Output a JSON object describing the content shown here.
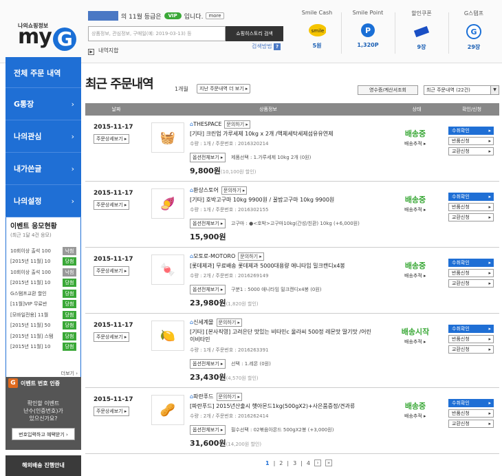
{
  "header": {
    "logo_small": "나의쇼핑정보",
    "logo_text": "my",
    "logo_g": "G",
    "grade_text": "의 11월 등급은",
    "grade_badge": "VIP",
    "grade_suffix": "입니다.",
    "more_label": "more",
    "search_placeholder": "상품정보, 관심정보, 구매일(예: 2019-03-13) 등",
    "search_button": "쇼핑히스토리 검색",
    "search_help": "검색방법",
    "history_label": "내역지합",
    "boxes": [
      {
        "label": "Smile Cash",
        "value": "5원",
        "icon": "smile-icon"
      },
      {
        "label": "Smile Point",
        "value": "1,320P",
        "icon": "point-icon"
      },
      {
        "label": "할인쿠폰",
        "value": "9장",
        "icon": "coupon-icon"
      },
      {
        "label": "G스탬프",
        "value": "29장",
        "icon": "stamp-icon"
      }
    ]
  },
  "sidebar": {
    "items": [
      {
        "label": "전체 주문 내역"
      },
      {
        "label": "G통장"
      },
      {
        "label": "나의관심"
      },
      {
        "label": "내가쓴글"
      },
      {
        "label": "나의설정"
      }
    ],
    "event": {
      "title": "이벤트 응모현황",
      "subtitle": "(최근 1달 4건 응모)",
      "rows": [
        {
          "name": "10회이상 출석 100",
          "result": "낙첨",
          "win": false
        },
        {
          "name": "[2015년 11월] 10",
          "result": "당첨",
          "win": true
        },
        {
          "name": "10회이상 출석 100",
          "result": "낙첨",
          "win": false
        },
        {
          "name": "[2015년 11월] 10",
          "result": "당첨",
          "win": true
        },
        {
          "name": "G스탬프교환 할인",
          "result": "당첨",
          "win": true
        },
        {
          "name": "[11월]VIP 무료반",
          "result": "당첨",
          "win": true
        },
        {
          "name": "[모바일전용] 11월",
          "result": "당첨",
          "win": true
        },
        {
          "name": "[2015년 11월] 50",
          "result": "당첨",
          "win": true
        },
        {
          "name": "[2015년 11월] 스탬",
          "result": "당첨",
          "win": true
        },
        {
          "name": "[2015년 11월] 10",
          "result": "당첨",
          "win": true
        }
      ],
      "more": "더보기"
    },
    "verify": {
      "title": "이벤트 번호 인증",
      "text1": "확인할 이벤트",
      "text2": "난수(인증번호)가",
      "text3": "있으신가요?",
      "button": "번호입력하고 혜택받기"
    },
    "overseas": "해외배송 진행안내"
  },
  "main": {
    "title": "최근 주문내역",
    "period": "1개월",
    "title_more": "지난 주문내역 더 보기",
    "receipt_button": "영수증/계산서조회",
    "select_value": "최근 주문내역 (22건)",
    "columns": [
      "날짜",
      "상품정보",
      "상태",
      "확인/신청"
    ],
    "orders": [
      {
        "date": "2015-11-17",
        "detail_btn": "주문상세보기",
        "shop": "THESPACE",
        "inquiry": "문의하기",
        "name": "[기타] 크린업 가루세제 10kg x 2개 /액체세탁세제섬유유연제",
        "meta": "수량 : 1개 / 주문번호 : 2016320214",
        "opt_btn": "옵션전체보기",
        "option": "제품선택 : 1.가루세제 10kg 2개 (0원)",
        "price": "9,800원",
        "discount": "(10,100원 할인)",
        "status": "배송중",
        "track": "배송추적",
        "actions": [
          "수취확인",
          "반품신청",
          "교환신청"
        ]
      },
      {
        "date": "2015-11-17",
        "detail_btn": "주문상세보기",
        "shop": "환상스토어",
        "inquiry": "문의하기",
        "name": "[기타] 호박고구마 10kg 9900원 / 꿀밤고구마 10kg 9900원",
        "meta": "수량 : 1개 / 주문번호 : 2016302155",
        "opt_btn": "옵션전체보기",
        "option": "고구마 : ●<호박>고구마10kg(간성/친환) 10kg (+6,000원)",
        "price": "15,900원",
        "discount": "",
        "status": "배송중",
        "track": "배송추적",
        "actions": [
          "수취확인",
          "반품신청",
          "교환신청"
        ]
      },
      {
        "date": "2015-11-17",
        "detail_btn": "주문상세보기",
        "shop": "모토로-MOTORO",
        "inquiry": "문의하기",
        "name": "[롯데제과] 무료배송 롯데제과 5000대용량 애니타임 밀크캔디x4봉",
        "meta": "수량 : 2개 / 주문번호 : 2016269149",
        "opt_btn": "옵션전체보기",
        "option": "구분1 : 5000 애니타임 밀크캔디x4봉 (0원)",
        "price": "23,980원",
        "discount": "(1,820원 할인)",
        "status": "배송중",
        "track": "배송추적",
        "actions": [
          "수취확인",
          "반품신청",
          "교환신청"
        ]
      },
      {
        "date": "2015-11-17",
        "detail_btn": "주문상세보기",
        "shop": "신세계몰",
        "inquiry": "문의하기",
        "name": "[기타] [본사직영] 고려은단 맛있는 비타민c 울라씨 500정 레몬맛 딸기맛 /어린이비타민",
        "meta": "수량 : 1개 / 주문번호 : 2016263391",
        "opt_btn": "옵션전체보기",
        "option": "선택 : 1.레몬 (0원)",
        "price": "23,430원",
        "discount": "(4,570원 할인)",
        "status": "배송시작",
        "track": "배송추적",
        "actions": [
          "수취확인",
          "반품신청",
          "교환신청"
        ]
      },
      {
        "date": "2015-11-17",
        "detail_btn": "주문상세보기",
        "shop": "파란푸드",
        "inquiry": "문의하기",
        "name": "[파란푸드] 2015년산출시 햇아몬드1kg(500gX2)+사은품증정/견과류",
        "meta": "수량 : 2개 / 주문번호 : 2016262414",
        "opt_btn": "옵션전체보기",
        "option": "필수선택 : 02볶음아몬드 500gX2봉 (+3,000원)",
        "price": "31,600원",
        "discount": "(14,200원 할인)",
        "status": "배송중",
        "track": "배송추적",
        "actions": [
          "수취확인",
          "반품신청",
          "교환신청"
        ]
      }
    ],
    "pager": [
      "1",
      "2",
      "3",
      "4"
    ]
  }
}
